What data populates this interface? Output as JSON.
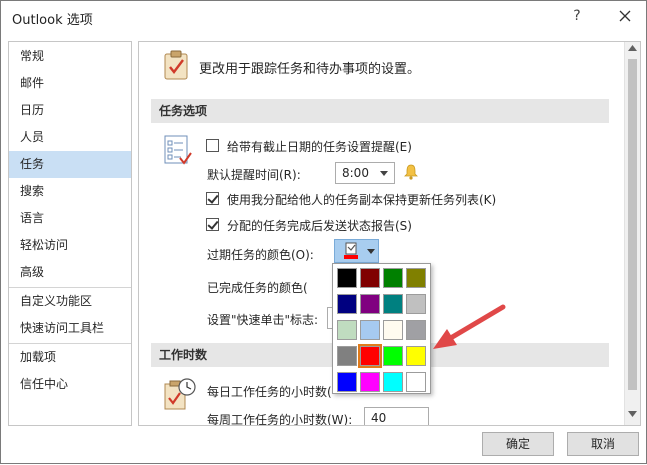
{
  "window": {
    "title": "Outlook 选项",
    "help": "?",
    "close_icon": "close-icon"
  },
  "sidebar": {
    "items": [
      {
        "label": "常规"
      },
      {
        "label": "邮件"
      },
      {
        "label": "日历"
      },
      {
        "label": "人员"
      },
      {
        "label": "任务",
        "selected": true
      },
      {
        "label": "搜索"
      },
      {
        "label": "语言"
      },
      {
        "label": "轻松访问"
      },
      {
        "label": "高级"
      },
      {
        "label": "自定义功能区"
      },
      {
        "label": "快速访问工具栏"
      },
      {
        "label": "加载项"
      },
      {
        "label": "信任中心"
      }
    ]
  },
  "main": {
    "header": "更改用于跟踪任务和待办事项的设置。",
    "section_task_options": "任务选项",
    "reminder_checkbox": {
      "label": "给带有截止日期的任务设置提醒(E)",
      "checked": false
    },
    "default_reminder_label": "默认提醒时间(R):",
    "default_reminder_value": "8:00",
    "keep_copy_checkbox": {
      "label": "使用我分配给他人的任务副本保持更新任务列表(K)",
      "checked": true
    },
    "status_report_checkbox": {
      "label": "分配的任务完成后发送状态报告(S)",
      "checked": true
    },
    "overdue_color_label": "过期任务的颜色(O):",
    "completed_color_label": "已完成任务的颜色(",
    "quick_click_label": "设置\"快速单击\"标志:",
    "section_work_hours": "工作时数",
    "daily_hours_label": "每日工作任务的小时数(",
    "weekly_hours_label": "每周工作任务的小时数(W):",
    "weekly_hours_value": "40"
  },
  "palette": {
    "selected_color": "#ff0000",
    "rows": [
      [
        "#000000",
        "#800000",
        "#008000",
        "#808000"
      ],
      [
        "#000080",
        "#800080",
        "#008080",
        "#c0c0c0"
      ],
      [
        "#c0dcc0",
        "#a6caf0",
        "#fffbf0",
        "#a0a0a4"
      ],
      [
        "#808080",
        "#ff0000",
        "#00ff00",
        "#ffff00"
      ],
      [
        "#0000ff",
        "#ff00ff",
        "#00ffff",
        "#ffffff"
      ]
    ]
  },
  "buttons": {
    "ok": "确定",
    "cancel": "取消"
  },
  "colors": {
    "selection": "#c9dff4",
    "section_bg": "#e6e6e6",
    "annotation_arrow": "#e04848"
  }
}
